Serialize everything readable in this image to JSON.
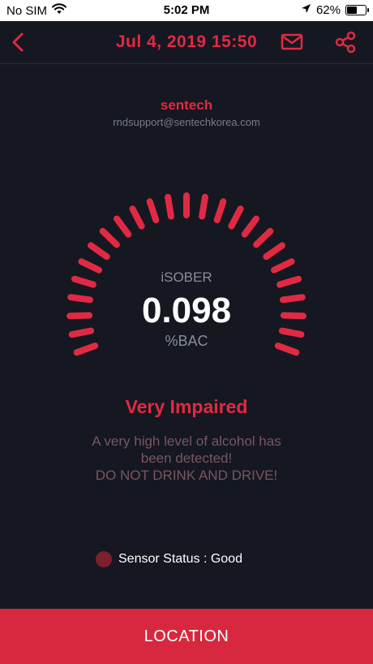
{
  "status_bar": {
    "carrier": "No SIM",
    "time": "5:02 PM",
    "battery": "62%",
    "battery_level": 0.62,
    "icons": [
      "wifi-icon",
      "location-arrow-icon",
      "battery-icon"
    ]
  },
  "nav": {
    "title": "Jul 4, 2019 15:50",
    "icons": [
      "back-chevron-icon",
      "mail-icon",
      "share-icon"
    ]
  },
  "user": {
    "name": "sentech",
    "email": "rndsupport@sentechkorea.com"
  },
  "gauge": {
    "brand": "iSOBER",
    "value": "0.098",
    "unit": "%BAC"
  },
  "result": {
    "level": "Very Impaired",
    "message_line1": "A very high level of alcohol has",
    "message_line2": "been detected!",
    "message_line3": "DO NOT DRINK AND DRIVE!"
  },
  "sensor": {
    "label": "Sensor Status : Good"
  },
  "actions": {
    "location_label": "LOCATION"
  },
  "colors": {
    "accent": "#e02a44",
    "background": "#151820",
    "button": "#d7283f",
    "sensor_dot": "#7d1f2c"
  }
}
